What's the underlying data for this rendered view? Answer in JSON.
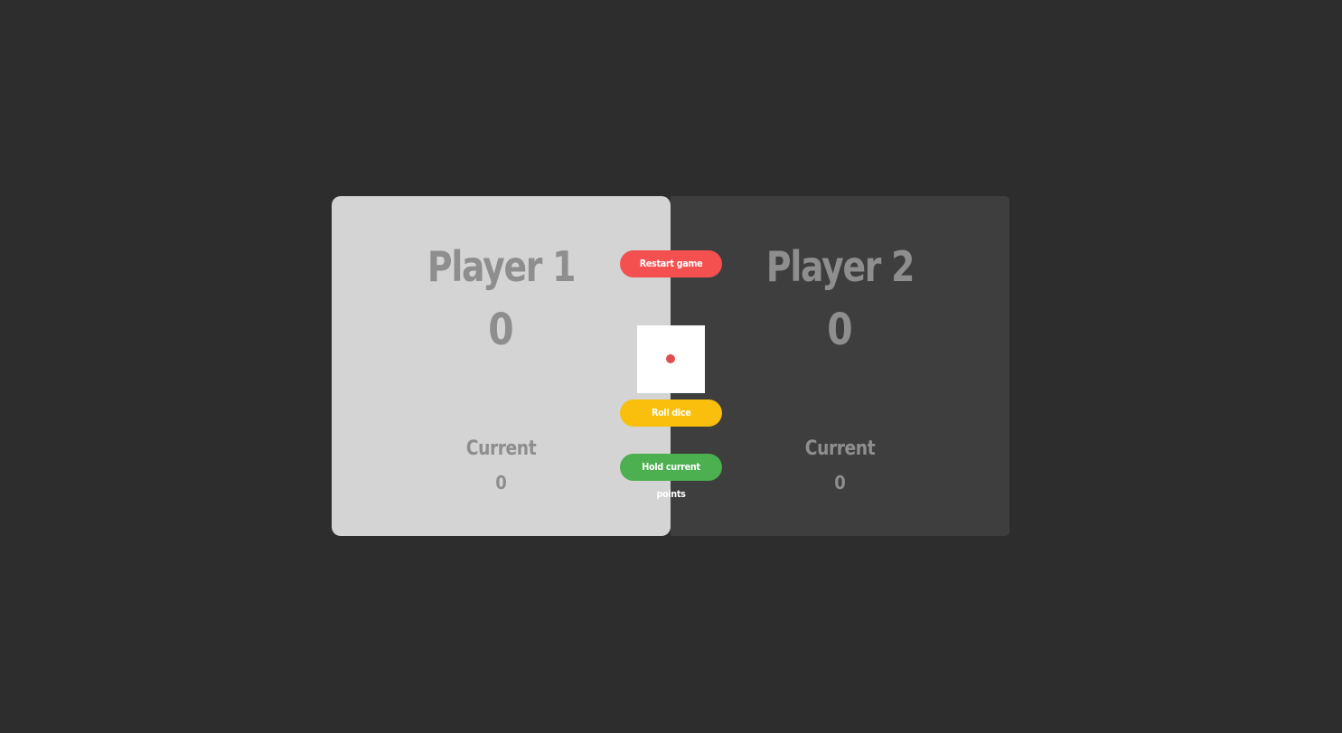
{
  "players": [
    {
      "name": "Player 1",
      "score": "0",
      "current_label": "Current",
      "current_score": "0",
      "active": true
    },
    {
      "name": "Player 2",
      "score": "0",
      "current_label": "Current",
      "current_score": "0",
      "active": false
    }
  ],
  "controls": {
    "restart_label": "Restart game",
    "roll_label": "Roll dice",
    "hold_label": "Hold current points"
  },
  "dice": {
    "value": 1,
    "pip_color": "#e24e4e"
  },
  "colors": {
    "background": "#2d2d2d",
    "active_panel": "#d4d4d4",
    "inactive_panel": "#3e3e3e",
    "restart": "#f45050",
    "roll": "#f9bf0c",
    "hold": "#4caf50"
  }
}
